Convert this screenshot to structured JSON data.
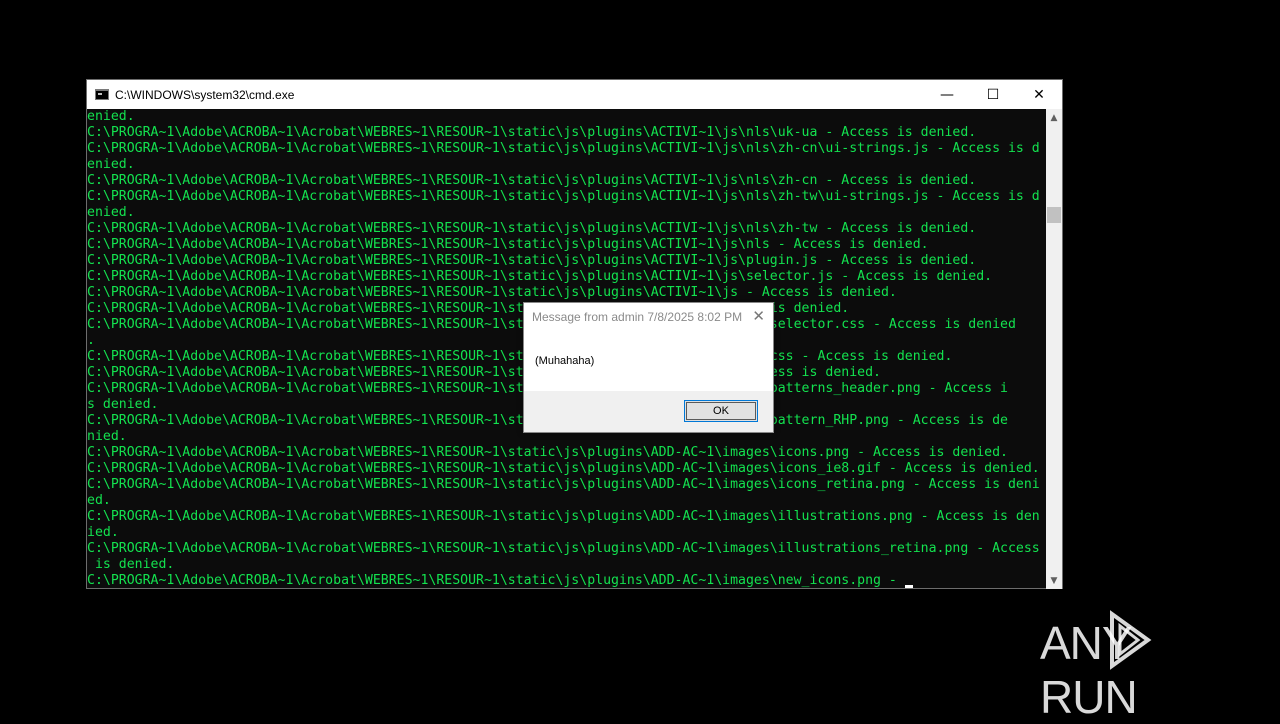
{
  "window": {
    "title": "C:\\WINDOWS\\system32\\cmd.exe",
    "minimize_glyph": "—",
    "maximize_glyph": "☐",
    "close_glyph": "✕"
  },
  "terminal": {
    "lines": [
      "enied.",
      "C:\\PROGRA~1\\Adobe\\ACROBA~1\\Acrobat\\WEBRES~1\\RESOUR~1\\static\\js\\plugins\\ACTIVI~1\\js\\nls\\uk-ua - Access is denied.",
      "C:\\PROGRA~1\\Adobe\\ACROBA~1\\Acrobat\\WEBRES~1\\RESOUR~1\\static\\js\\plugins\\ACTIVI~1\\js\\nls\\zh-cn\\ui-strings.js - Access is d",
      "enied.",
      "C:\\PROGRA~1\\Adobe\\ACROBA~1\\Acrobat\\WEBRES~1\\RESOUR~1\\static\\js\\plugins\\ACTIVI~1\\js\\nls\\zh-cn - Access is denied.",
      "C:\\PROGRA~1\\Adobe\\ACROBA~1\\Acrobat\\WEBRES~1\\RESOUR~1\\static\\js\\plugins\\ACTIVI~1\\js\\nls\\zh-tw\\ui-strings.js - Access is d",
      "enied.",
      "C:\\PROGRA~1\\Adobe\\ACROBA~1\\Acrobat\\WEBRES~1\\RESOUR~1\\static\\js\\plugins\\ACTIVI~1\\js\\nls\\zh-tw - Access is denied.",
      "C:\\PROGRA~1\\Adobe\\ACROBA~1\\Acrobat\\WEBRES~1\\RESOUR~1\\static\\js\\plugins\\ACTIVI~1\\js\\nls - Access is denied.",
      "C:\\PROGRA~1\\Adobe\\ACROBA~1\\Acrobat\\WEBRES~1\\RESOUR~1\\static\\js\\plugins\\ACTIVI~1\\js\\plugin.js - Access is denied.",
      "C:\\PROGRA~1\\Adobe\\ACROBA~1\\Acrobat\\WEBRES~1\\RESOUR~1\\static\\js\\plugins\\ACTIVI~1\\js\\selector.js - Access is denied.",
      "C:\\PROGRA~1\\Adobe\\ACROBA~1\\Acrobat\\WEBRES~1\\RESOUR~1\\static\\js\\plugins\\ACTIVI~1\\js - Access is denied.",
      "C:\\PROGRA~1\\Adobe\\ACROBA~1\\Acrobat\\WEBRES~1\\RESOUR~1\\st                            ss is denied.",
      "C:\\PROGRA~1\\Adobe\\ACROBA~1\\Acrobat\\WEBRES~1\\RESOUR~1\\st                            in-selector.css - Access is denied",
      ".",
      "C:\\PROGRA~1\\Adobe\\ACROBA~1\\Acrobat\\WEBRES~1\\RESOUR~1\\st                            in.css - Access is denied.",
      "C:\\PROGRA~1\\Adobe\\ACROBA~1\\Acrobat\\WEBRES~1\\RESOUR~1\\st                            Access is denied.",
      "C:\\PROGRA~1\\Adobe\\ACROBA~1\\Acrobat\\WEBRES~1\\RESOUR~1\\st                            bg_patterns_header.png - Access i",
      "s denied.",
      "C:\\PROGRA~1\\Adobe\\ACROBA~1\\Acrobat\\WEBRES~1\\RESOUR~1\\st                            bg_pattern_RHP.png - Access is de",
      "nied.",
      "C:\\PROGRA~1\\Adobe\\ACROBA~1\\Acrobat\\WEBRES~1\\RESOUR~1\\static\\js\\plugins\\ADD-AC~1\\images\\icons.png - Access is denied.",
      "C:\\PROGRA~1\\Adobe\\ACROBA~1\\Acrobat\\WEBRES~1\\RESOUR~1\\static\\js\\plugins\\ADD-AC~1\\images\\icons_ie8.gif - Access is denied.",
      "C:\\PROGRA~1\\Adobe\\ACROBA~1\\Acrobat\\WEBRES~1\\RESOUR~1\\static\\js\\plugins\\ADD-AC~1\\images\\icons_retina.png - Access is deni",
      "ed.",
      "C:\\PROGRA~1\\Adobe\\ACROBA~1\\Acrobat\\WEBRES~1\\RESOUR~1\\static\\js\\plugins\\ADD-AC~1\\images\\illustrations.png - Access is den",
      "ied.",
      "C:\\PROGRA~1\\Adobe\\ACROBA~1\\Acrobat\\WEBRES~1\\RESOUR~1\\static\\js\\plugins\\ADD-AC~1\\images\\illustrations_retina.png - Access",
      " is denied.",
      "C:\\PROGRA~1\\Adobe\\ACROBA~1\\Acrobat\\WEBRES~1\\RESOUR~1\\static\\js\\plugins\\ADD-AC~1\\images\\new_icons.png - "
    ]
  },
  "dialog": {
    "title": "Message from admin 7/8/2025 8:02 PM",
    "message": "(Muhahaha)",
    "ok_label": "OK",
    "close_glyph": "✕"
  },
  "watermark": {
    "text": "ANY RUN"
  },
  "colors": {
    "terminal_text": "#13e24f",
    "terminal_bg": "#0c0c0c",
    "accent": "#0078d7"
  }
}
